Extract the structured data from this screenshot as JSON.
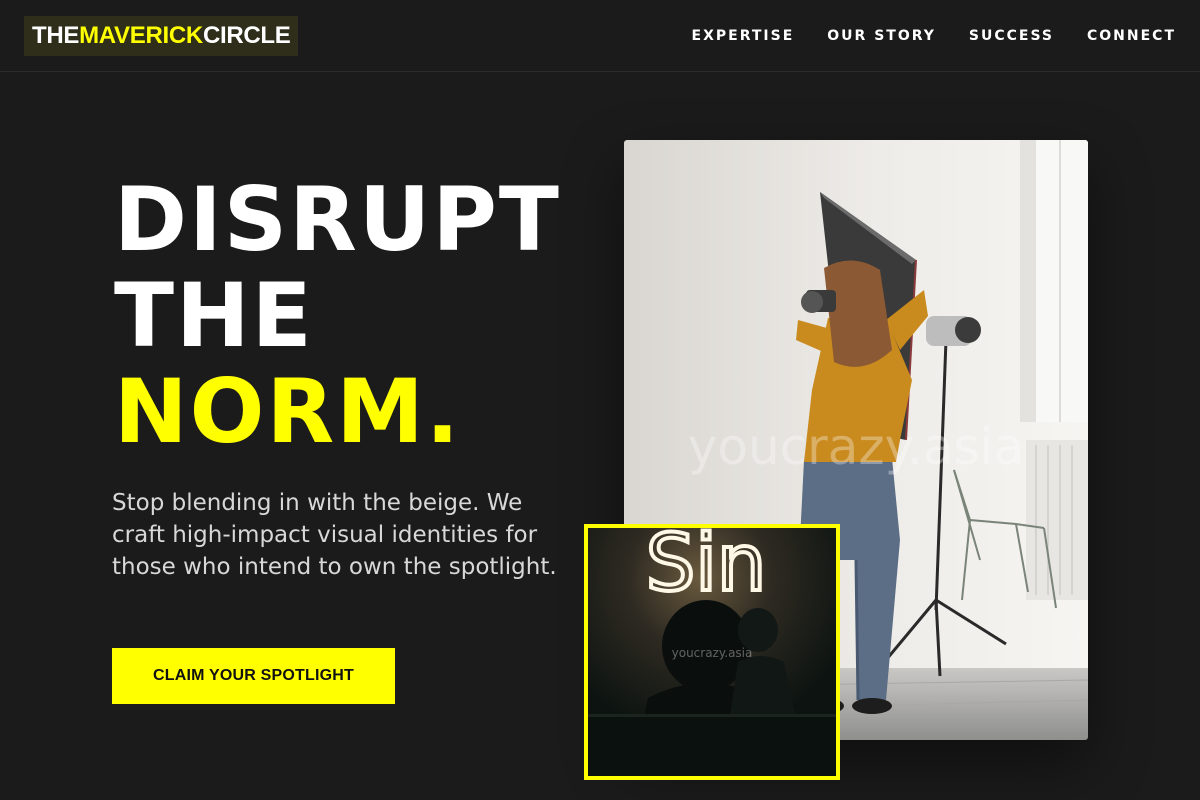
{
  "brand": {
    "part1": "THE ",
    "part2": "MAVERICK",
    "part3": " CIRCLE"
  },
  "nav": {
    "items": [
      {
        "label": "EXPERTISE"
      },
      {
        "label": "OUR STORY"
      },
      {
        "label": "SUCCESS"
      },
      {
        "label": "CONNECT"
      }
    ]
  },
  "hero": {
    "headline_line1": "DISRUPT",
    "headline_line2": "THE",
    "headline_line3": "NORM.",
    "lead": "Stop blending in with the beige. We craft high-impact visual identities for those who intend to own the spotlight.",
    "cta_label": "CLAIM YOUR SPOTLIGHT"
  },
  "images": {
    "main_watermark": "youcrazy.asia",
    "inset_watermark": "youcrazy.asia",
    "inset_neon_text": "Sin"
  },
  "colors": {
    "background": "#1b1b1b",
    "accent": "#ffff00",
    "text": "#ffffff",
    "muted_text": "#d8d8d8"
  }
}
